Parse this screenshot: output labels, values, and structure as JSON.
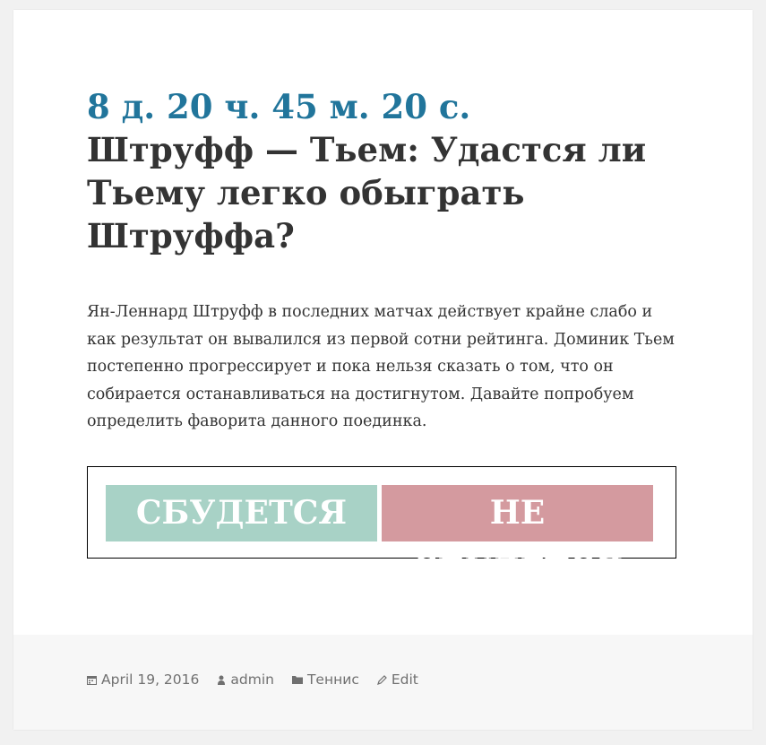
{
  "post": {
    "countdown": "8 д. 20 ч. 45 м. 20 с.",
    "title": "Штруфф — Тьем: Удастся ли Тьему легко обыграть Штруффа?",
    "excerpt": "Ян-Леннард Штруфф в последних матчах действует крайне слабо и как результат он вывалился из первой сотни рейтинга. Доминик Тьем постепенно прогрессирует и пока нельзя сказать о том, что он собирается останавливаться на достигнутом. Давайте попробуем определить фаворита данного поединка."
  },
  "vote": {
    "yes_label": "СБУДЕТСЯ",
    "no_label": "НЕ СБУДЕТСЯ",
    "yes_color": "#a8d2c6",
    "no_color": "#d49a9f"
  },
  "meta": {
    "date": "April 19, 2016",
    "author": "admin",
    "category": "Теннис",
    "edit_label": "Edit",
    "icons": [
      "calendar-icon",
      "user-icon",
      "folder-icon",
      "pencil-icon"
    ]
  }
}
